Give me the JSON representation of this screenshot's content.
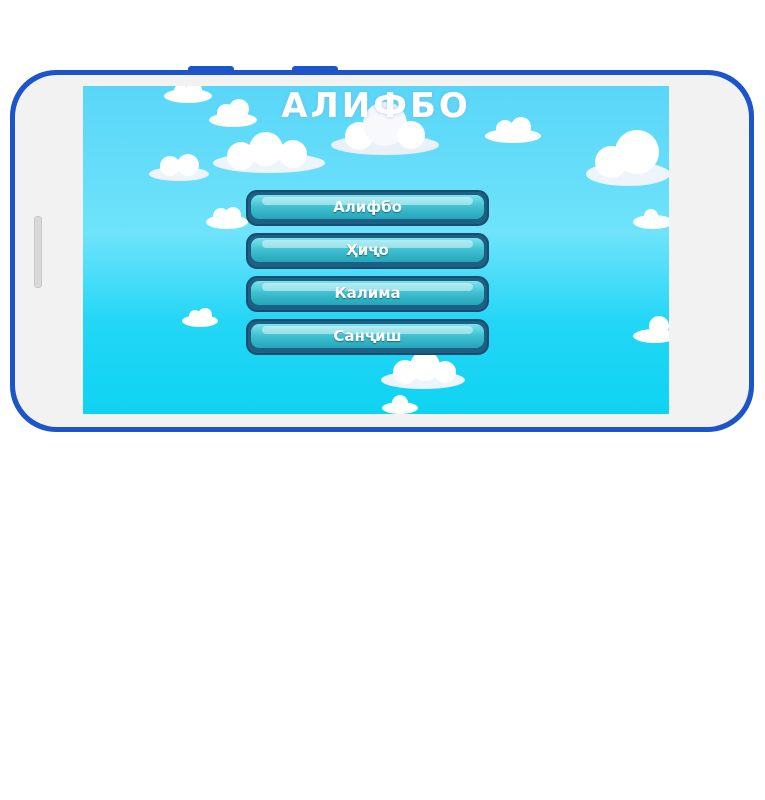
{
  "app": {
    "title": "АЛИФБО"
  },
  "menu": {
    "items": [
      {
        "label": "Алифбо"
      },
      {
        "label": "Ҳиҷо"
      },
      {
        "label": "Калима"
      },
      {
        "label": "Санҷиш"
      }
    ]
  },
  "theme": {
    "sky_top": "#5ad6f8",
    "sky_bottom": "#0fd3f2",
    "phone_frame": "#1b55c9",
    "button_face": "#3fbfd0",
    "button_border": "#174e70"
  },
  "icons": [
    "cloud-icon"
  ]
}
